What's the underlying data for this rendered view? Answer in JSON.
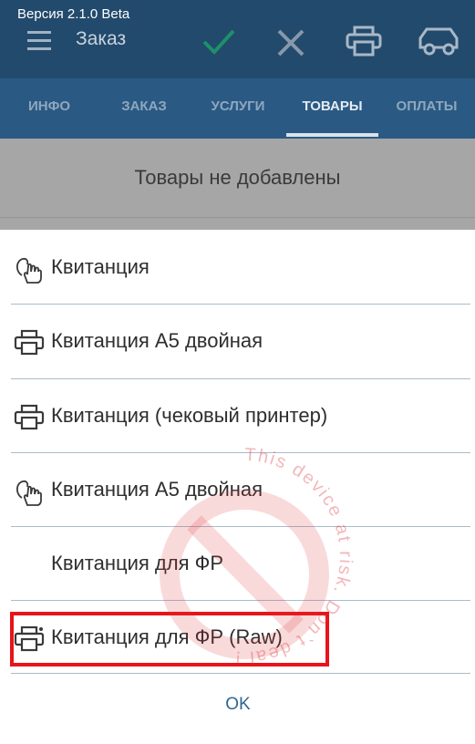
{
  "header": {
    "version": "Версия 2.1.0 Beta",
    "title": "Заказ",
    "icons": [
      "menu-icon",
      "check-icon",
      "close-icon",
      "printer-icon",
      "car-icon"
    ],
    "accent_check": "#1f8f6a"
  },
  "tabs": [
    {
      "label": "ИНФО"
    },
    {
      "label": "ЗАКАЗ"
    },
    {
      "label": "УСЛУГИ"
    },
    {
      "label": "ТОВАРЫ",
      "active": true
    },
    {
      "label": "ОПЛАТЫ"
    }
  ],
  "content": {
    "empty_message": "Товары не добавлены"
  },
  "dialog": {
    "items": [
      {
        "label": "Квитанция",
        "icon": "touch-hand-icon"
      },
      {
        "label": "Квитанция A5 двойная",
        "icon": "printer-icon"
      },
      {
        "label": "Квитанция (чековый принтер)",
        "icon": "printer-icon"
      },
      {
        "label": "Квитанция A5 двойная",
        "icon": "touch-hand-icon"
      },
      {
        "label": "Квитанция для ФР",
        "icon": ""
      },
      {
        "label": "Квитанция для ФР (Raw)",
        "icon": "printer-icon",
        "highlighted": true
      }
    ],
    "ok_label": "OK"
  },
  "watermark": {
    "text": "This device at risk. Don`t deal !",
    "color": "#e0323a"
  }
}
